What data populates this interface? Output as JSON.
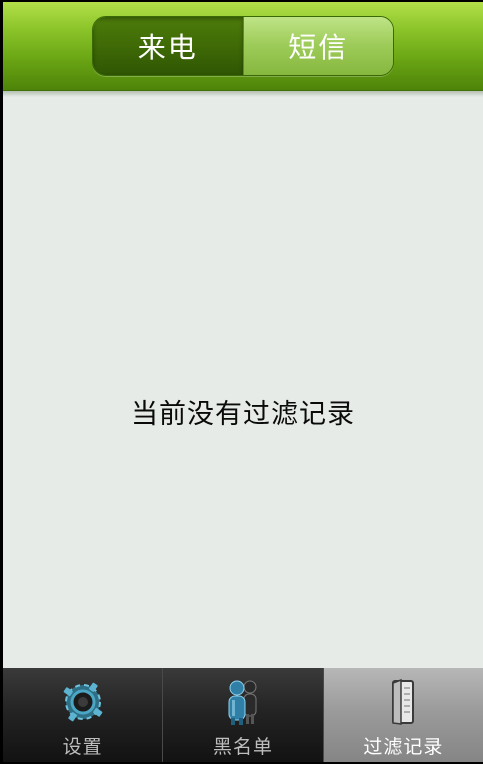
{
  "header": {
    "tabs": [
      {
        "label": "来电",
        "selected": true
      },
      {
        "label": "短信",
        "selected": false
      }
    ]
  },
  "main": {
    "empty_message": "当前没有过滤记录"
  },
  "tabbar": {
    "items": [
      {
        "label": "设置",
        "icon": "gear-icon",
        "selected": false
      },
      {
        "label": "黑名单",
        "icon": "people-icon",
        "selected": false
      },
      {
        "label": "过滤记录",
        "icon": "document-icon",
        "selected": true
      }
    ]
  },
  "colors": {
    "header_green": "#6aa514",
    "selected_segment": "#3f6a06",
    "unselected_segment": "#9fcd5b",
    "content_background": "#e6ebe7",
    "tabbar_dark": "#242424",
    "tabbar_active": "#9b9b9b"
  }
}
